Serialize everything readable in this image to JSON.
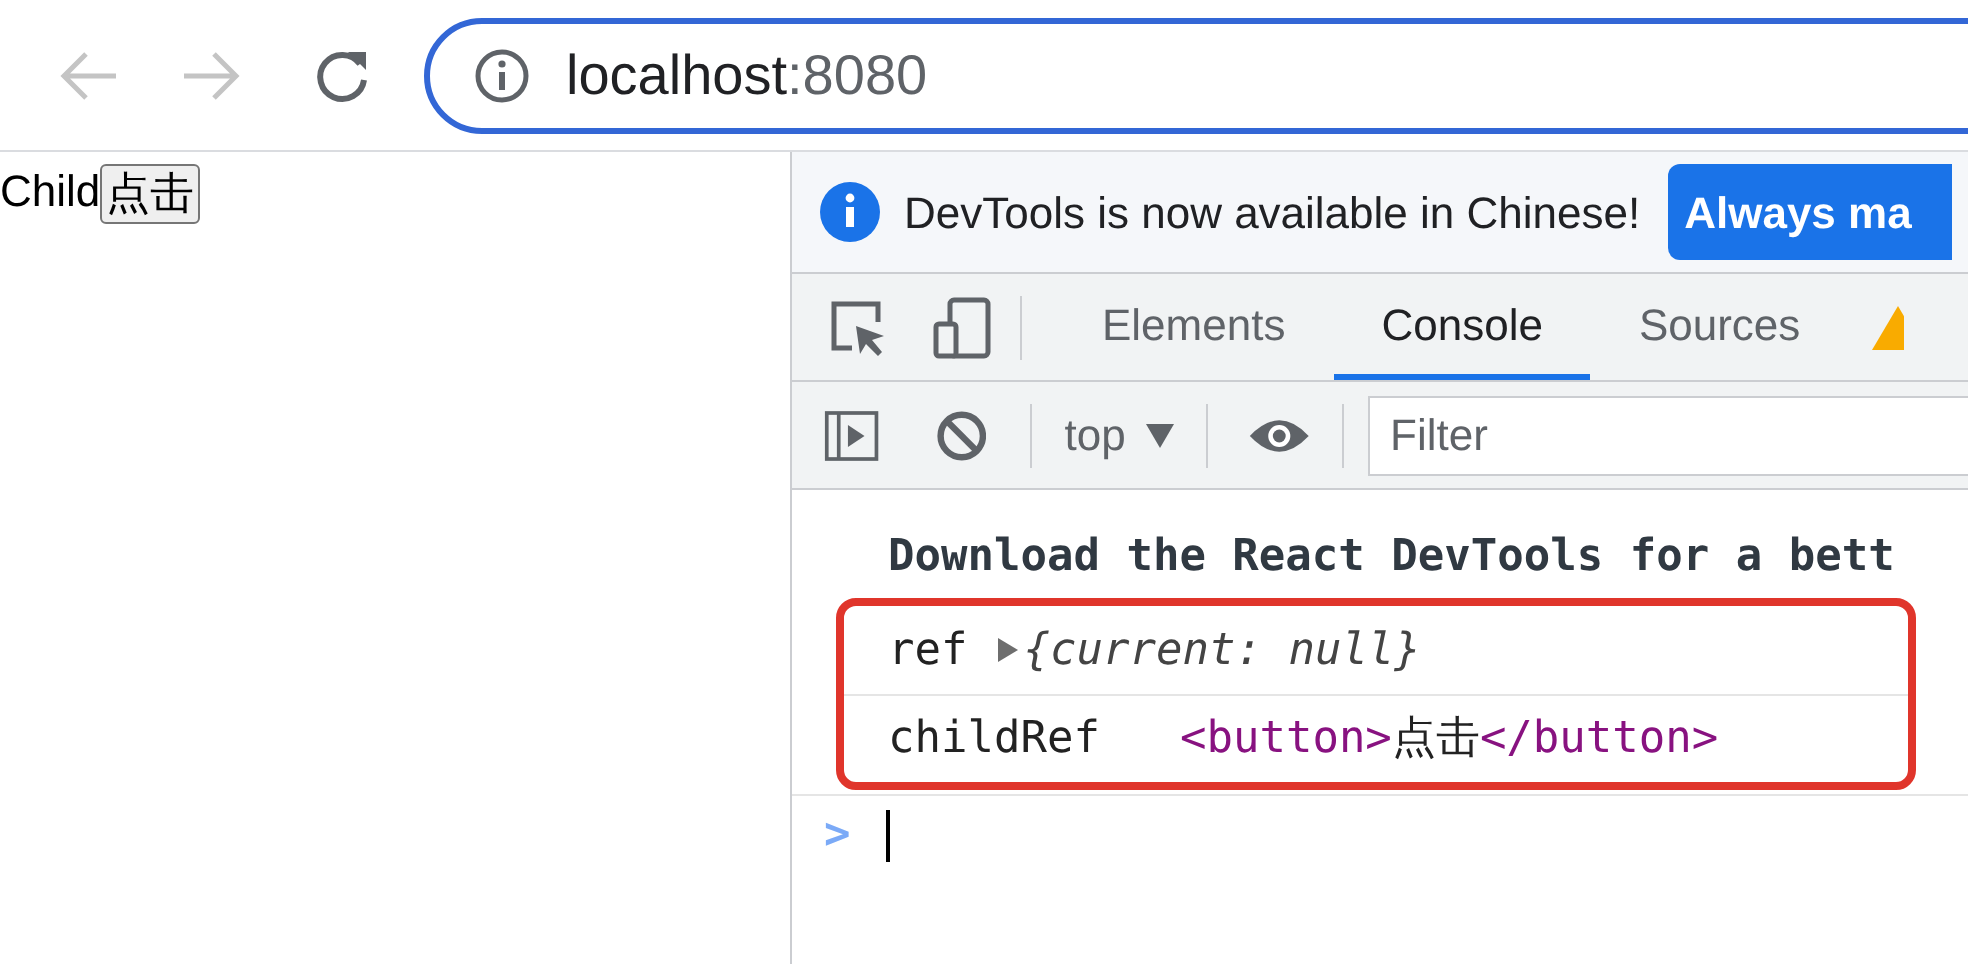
{
  "browser": {
    "address": {
      "host": "localhost",
      "port": ":8080"
    }
  },
  "page": {
    "label": "Child",
    "button": "点击"
  },
  "devtools": {
    "infobar": {
      "message": "DevTools is now available in Chinese!",
      "button": "Always ma"
    },
    "tabs": [
      {
        "label": "Elements",
        "selected": false
      },
      {
        "label": "Console",
        "selected": true
      },
      {
        "label": "Sources",
        "selected": false
      }
    ],
    "console_toolbar": {
      "context": "top",
      "filter": {
        "placeholder": "Filter"
      }
    },
    "messages": [
      {
        "kind": "banner",
        "text": "Download the React DevTools for a bett",
        "highlighted": false
      },
      {
        "kind": "object",
        "label": "ref",
        "preview": "{current: null}",
        "expanded": false,
        "highlighted": true
      },
      {
        "kind": "element",
        "label": "childRef",
        "open_tag": "<button>",
        "content": "点击",
        "close_tag": "</button>",
        "highlighted": true
      }
    ],
    "prompt": ">"
  }
}
